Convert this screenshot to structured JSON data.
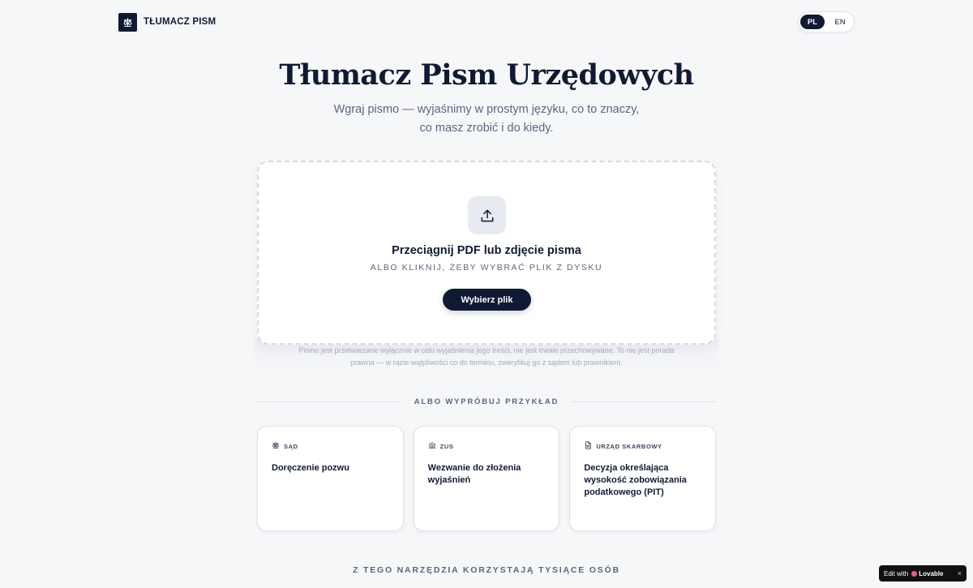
{
  "header": {
    "brand_name": "TŁUMACZ PISM",
    "brand_icon": "scales-icon",
    "languages": [
      {
        "label": "PL",
        "active": true
      },
      {
        "label": "EN",
        "active": false
      }
    ]
  },
  "hero": {
    "title": "Tłumacz Pism Urzędowych",
    "subtitle_line1": "Wgraj pismo — wyjaśnimy w prostym języku, co to znaczy,",
    "subtitle_line2": "co masz zrobić i do kiedy."
  },
  "upload": {
    "icon": "upload-icon",
    "title": "Przeciągnij PDF lub zdjęcie pisma",
    "subtitle": "ALBO KLIKNIJ, ŻEBY WYBRAĆ PLIK Z DYSKU",
    "button_label": "Wybierz plik",
    "disclaimer_line1": "Pismo jest przetwarzane wyłącznie w celu wyjaśnienia jego treści, nie jest trwale przechowywane. To nie jest porada",
    "disclaimer_line2": "prawna — w razie wątpliwości co do terminu, zweryfikuj go z sądem lub prawnikiem."
  },
  "examples": {
    "divider_label": "ALBO WYPRÓBUJ PRZYKŁAD",
    "items": [
      {
        "tag": "SĄD",
        "icon": "scales-icon",
        "title": "Doręczenie pozwu"
      },
      {
        "tag": "ZUS",
        "icon": "bank-icon",
        "title": "Wezwanie do złożenia wyjaśnień"
      },
      {
        "tag": "URZĄD SKARBOWY",
        "icon": "document-icon",
        "title": "Decyzja określająca wysokość zobowiązania podatkowego (PIT)"
      }
    ]
  },
  "footer": {
    "heading": "Z TEGO NARZĘDZIA KORZYSTAJĄ TYSIĄCE OSÓB"
  },
  "badge": {
    "prefix": "Edit with",
    "brand": "Lovable",
    "close": "×"
  },
  "colors": {
    "primary": "#101a33",
    "background": "#f6f7f9",
    "muted_text": "#5a6680"
  }
}
